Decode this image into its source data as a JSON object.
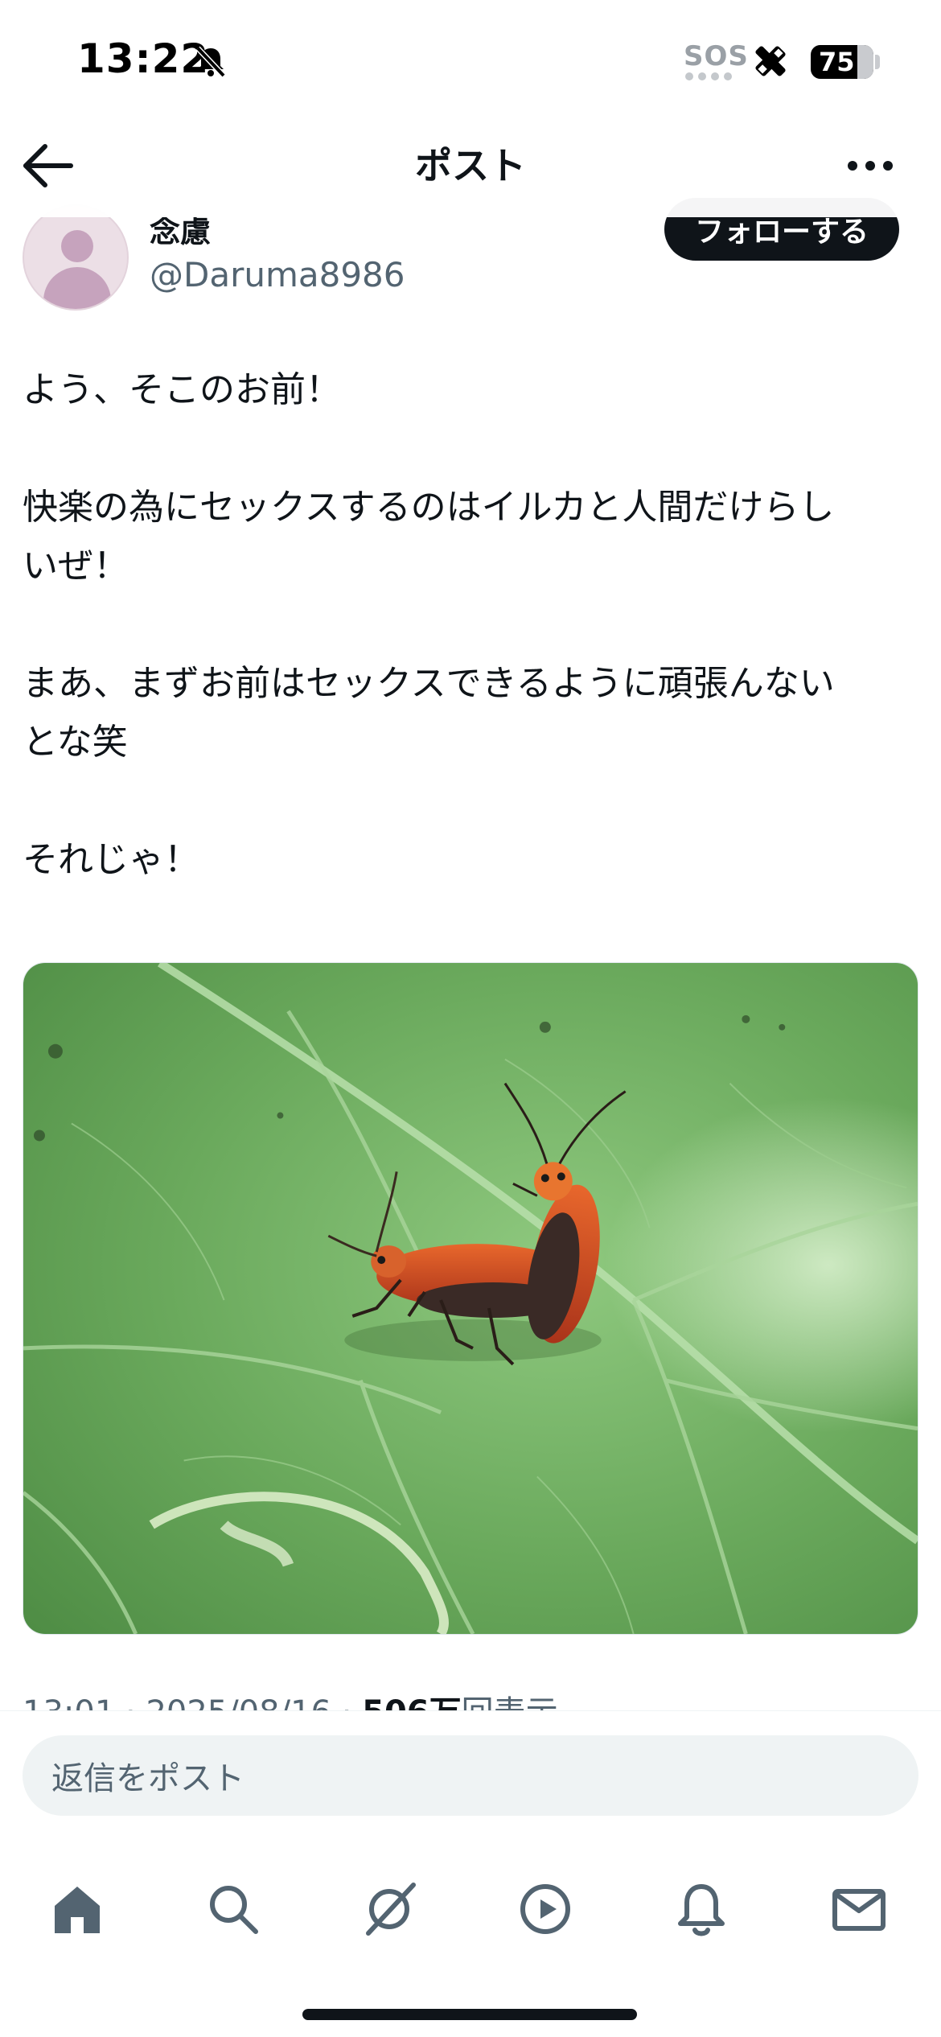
{
  "status_bar": {
    "time": "13:22",
    "sos": "SOS",
    "battery": "75",
    "battery_level": 0.75
  },
  "header": {
    "title": "ポスト",
    "back_icon": "arrow-left-icon",
    "more_icon": "ellipsis-icon"
  },
  "author": {
    "display_name": "念慮",
    "handle": "@Daruma8986",
    "follow_label": "フォローする"
  },
  "post": {
    "lines": [
      "よう、そこのお前！",
      "",
      "快楽の為にセックスするのはイルカと人間だけらし",
      "いぜ！",
      "",
      "まあ、まずお前はセックスできるように頑張んない",
      "とな笑",
      "",
      "それじゃ！"
    ],
    "image_description": "two orange beetles on a green leaf",
    "time": "13:01",
    "date": "2025/08/16",
    "views_number": "506万",
    "views_label": "回表示"
  },
  "reply": {
    "placeholder": "返信をポスト"
  },
  "tabbar": {
    "items": [
      {
        "name": "home",
        "icon": "home-icon"
      },
      {
        "name": "search",
        "icon": "search-icon"
      },
      {
        "name": "grok",
        "icon": "grok-icon"
      },
      {
        "name": "video",
        "icon": "play-icon"
      },
      {
        "name": "notifications",
        "icon": "bell-icon"
      },
      {
        "name": "messages",
        "icon": "mail-icon"
      }
    ]
  },
  "colors": {
    "text_primary": "#0f1419",
    "text_secondary": "#536471",
    "input_bg": "#eff3f4",
    "follow_bg": "#0f1419"
  }
}
